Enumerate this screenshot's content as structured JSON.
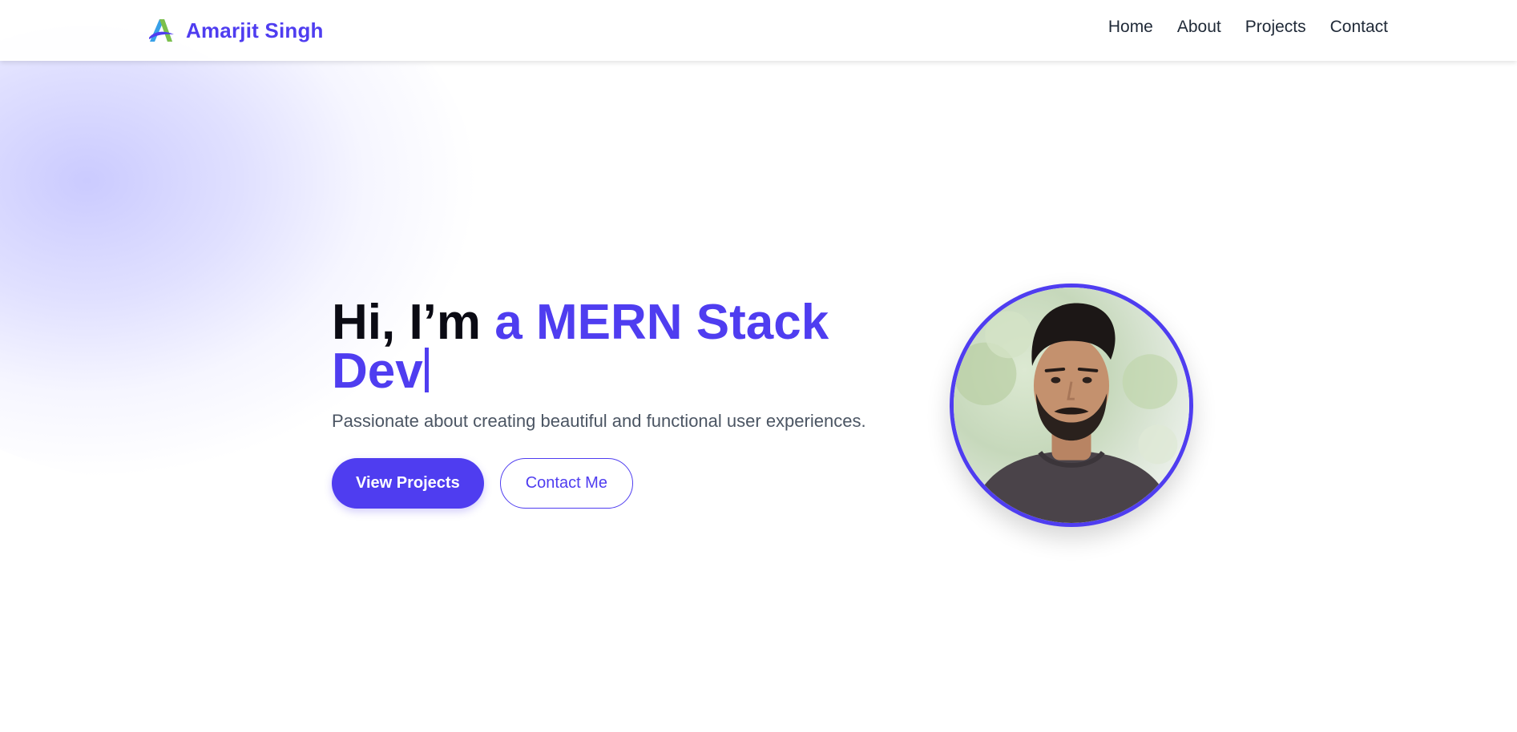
{
  "header": {
    "brand_name": "Amarjit Singh",
    "logo_icon": "letter-a-logo-icon"
  },
  "nav": {
    "items": [
      {
        "label": "Home"
      },
      {
        "label": "About"
      },
      {
        "label": "Projects"
      },
      {
        "label": "Contact"
      }
    ]
  },
  "hero": {
    "greeting": "Hi, I’m ",
    "role_typed": "a MERN Stack Dev",
    "tagline": "Passionate about creating beautiful and functional user experiences.",
    "primary_button": "View Projects",
    "secondary_button": "Contact Me",
    "avatar_image": "profile-photo"
  },
  "colors": {
    "accent": "#4f3df0",
    "text_dark": "#0b0b14",
    "text_muted": "#4b5563",
    "nav_text": "#1f2937",
    "blob": "#d6d6ff"
  }
}
